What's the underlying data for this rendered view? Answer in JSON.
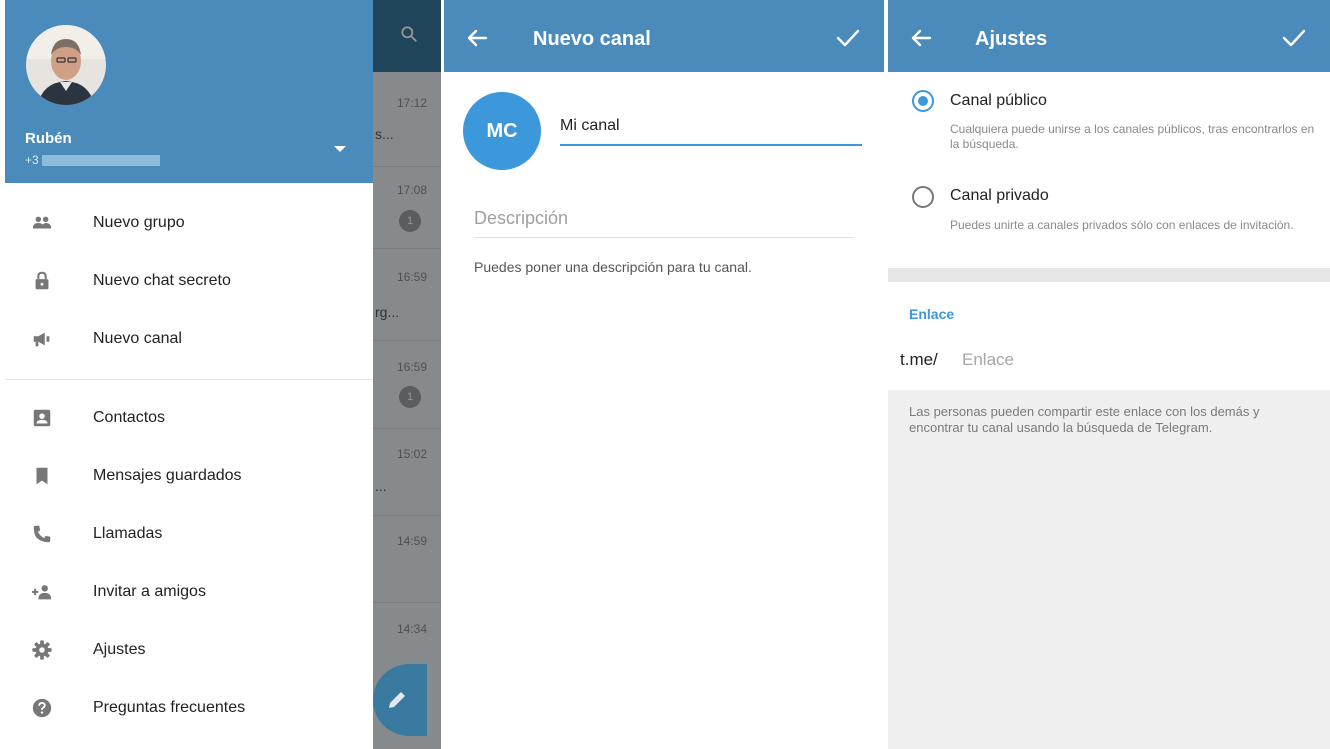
{
  "colors": {
    "header_blue": "#4a8bbb",
    "accent_blue": "#3c97db",
    "chat_bar_blue": "#38789d"
  },
  "drawer": {
    "user_name": "Rubén",
    "phone_prefix": "+3",
    "items_group1": [
      {
        "label": "Nuevo grupo",
        "icon": "group-icon"
      },
      {
        "label": "Nuevo chat secreto",
        "icon": "lock-icon"
      },
      {
        "label": "Nuevo canal",
        "icon": "megaphone-icon"
      }
    ],
    "items_group2": [
      {
        "label": "Contactos",
        "icon": "contact-icon"
      },
      {
        "label": "Mensajes guardados",
        "icon": "bookmark-icon"
      },
      {
        "label": "Llamadas",
        "icon": "phone-icon"
      },
      {
        "label": "Invitar a amigos",
        "icon": "add-person-icon"
      },
      {
        "label": "Ajustes",
        "icon": "gear-icon"
      },
      {
        "label": "Preguntas frecuentes",
        "icon": "help-icon"
      }
    ]
  },
  "chat_list": {
    "times": [
      "17:12",
      "17:08",
      "16:59",
      "16:59",
      "15:02",
      "14:59",
      "14:34"
    ],
    "fragments": [
      "s...",
      "rg...",
      "..."
    ],
    "badge": "1"
  },
  "new_channel": {
    "title": "Nuevo canal",
    "avatar_initials": "MC",
    "name_value": "Mi canal",
    "description_placeholder": "Descripción",
    "description_help": "Puedes poner una descripción para tu canal."
  },
  "settings": {
    "title": "Ajustes",
    "public_label": "Canal público",
    "public_desc": "Cualquiera puede unirse a los canales públicos, tras encontrarlos en la búsqueda.",
    "private_label": "Canal privado",
    "private_desc": "Puedes unirte a canales privados sólo con enlaces de invitación.",
    "selected": "public",
    "link_header": "Enlace",
    "link_prefix": "t.me/",
    "link_placeholder": "Enlace",
    "link_help": "Las personas pueden compartir este enlace con los demás y encontrar tu canal usando la búsqueda de Telegram."
  }
}
